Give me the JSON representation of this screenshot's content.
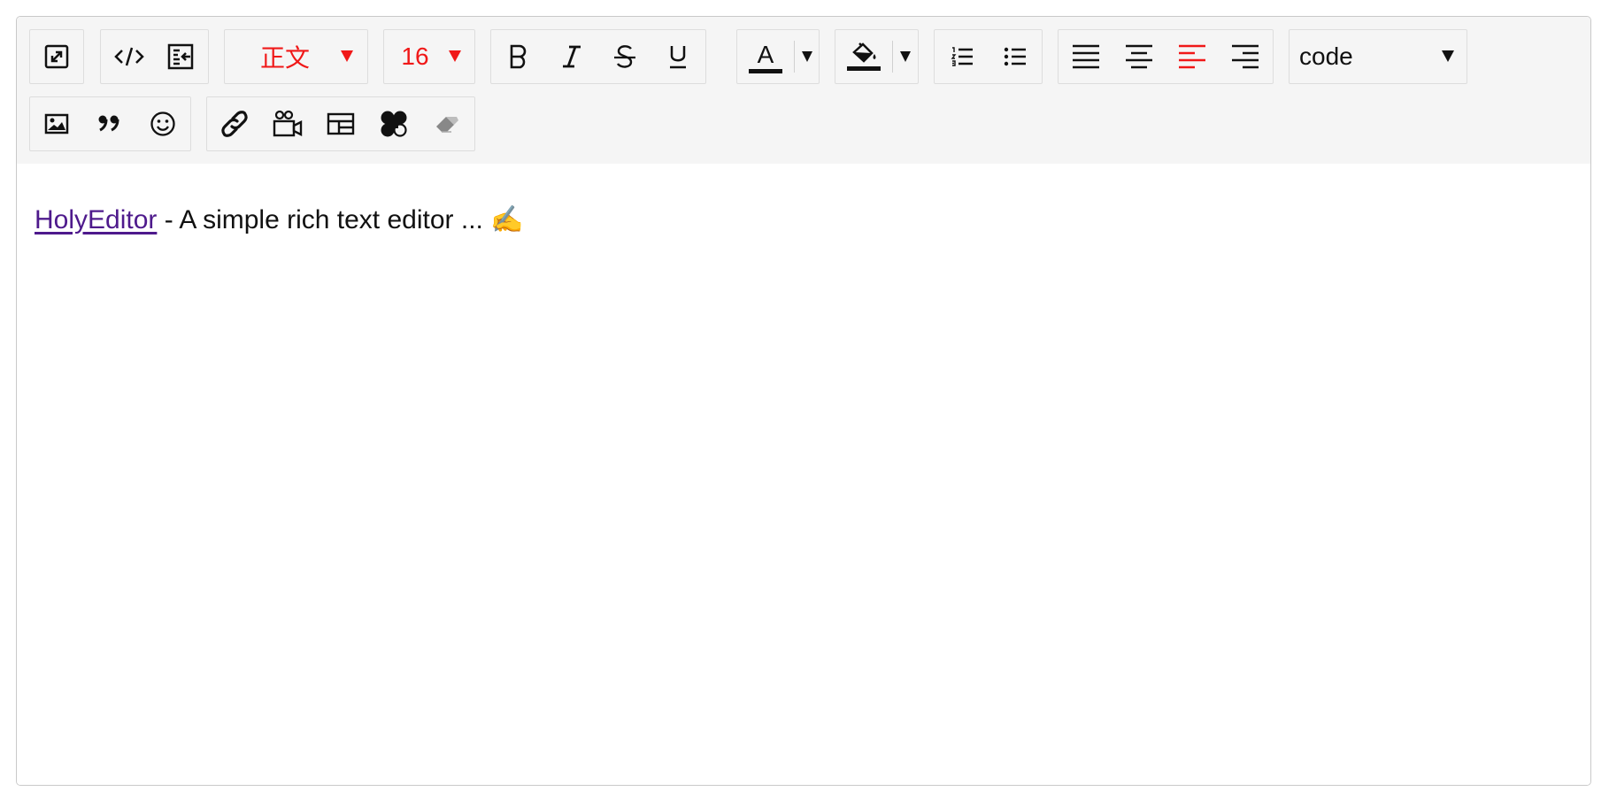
{
  "toolbar": {
    "heading_select": {
      "value": "正文"
    },
    "size_select": {
      "value": "16"
    },
    "font_color": {
      "glyph": "A"
    },
    "code_select": {
      "value": "code"
    },
    "accent_color": "#f01818"
  },
  "content": {
    "link_text": "HolyEditor",
    "text": " - A simple rich text editor ... ",
    "emoji": "✍️"
  }
}
